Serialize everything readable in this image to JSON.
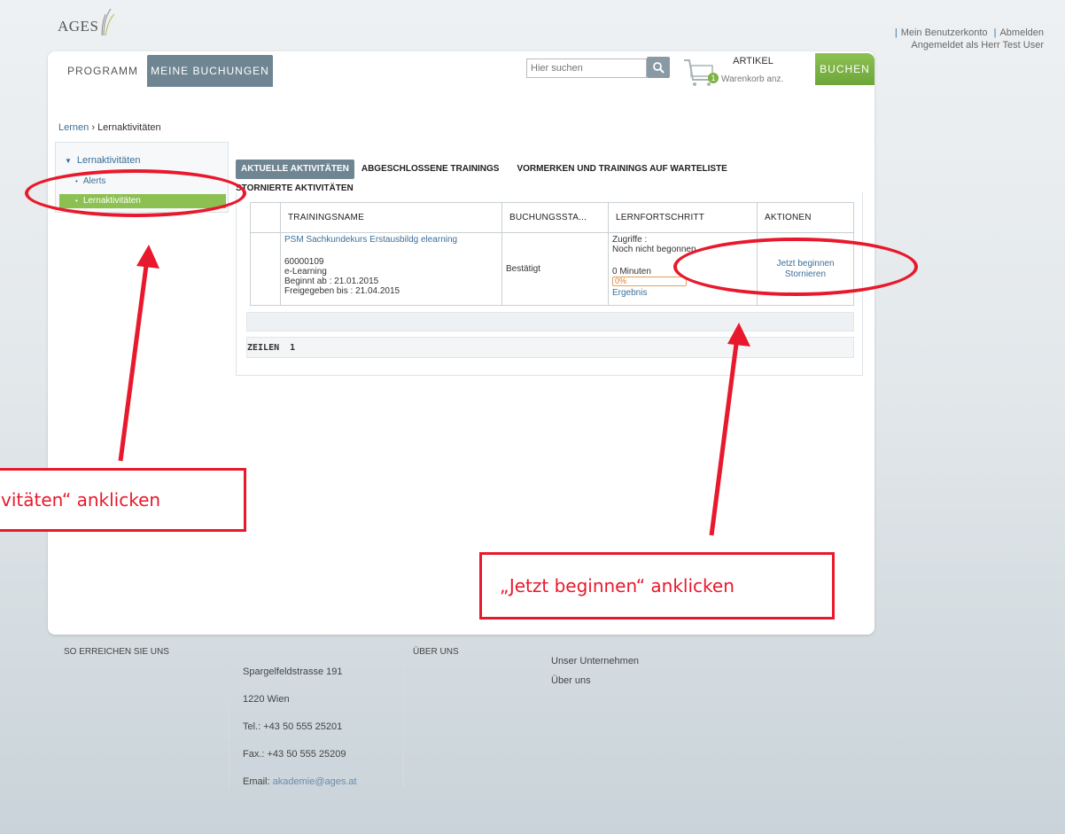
{
  "header": {
    "logo_text": "AGES",
    "account_link": "Mein Benutzerkonto",
    "logout_link": "Abmelden",
    "logged_in_as": "Angemeldet als Herr Test User"
  },
  "nav": {
    "programm": "PROGRAMM",
    "meine_buchungen": "MEINE BUCHUNGEN",
    "search_placeholder": "Hier suchen",
    "cart_count": "1",
    "cart_title": "ARTIKEL",
    "cart_sub": "Warenkorb anz.",
    "buchen": "BUCHEN"
  },
  "breadcrumb": {
    "root": "Lernen",
    "sep": "›",
    "current": "Lernaktivitäten"
  },
  "sidebar": {
    "heading": "Lernaktivitäten",
    "items": [
      {
        "label": "Alerts",
        "active": false
      },
      {
        "label": "Lernaktivitäten",
        "active": true
      }
    ]
  },
  "tabs": [
    {
      "label": "AKTUELLE AKTIVITÄTEN",
      "active": true
    },
    {
      "label": "ABGESCHLOSSENE TRAININGS",
      "active": false
    },
    {
      "label": "VORMERKEN UND TRAININGS AUF WARTELISTE",
      "active": false
    },
    {
      "label": "STORNIERTE AKTIVITÄTEN",
      "active": false
    }
  ],
  "table": {
    "columns": [
      "TRAININGSNAME",
      "BUCHUNGSSTA...",
      "LERNFORTSCHRITT",
      "AKTIONEN"
    ],
    "row": {
      "title": "PSM Sachkundekurs Erstausbildg elearning",
      "id": "60000109",
      "type": "e-Learning",
      "start": "Beginnt ab : 21.01.2015",
      "release": "Freigegeben bis : 21.04.2015",
      "status": "Bestätigt",
      "access_label": "Zugriffe :",
      "access_value": "Noch nicht begonnen",
      "minutes": "0 Minuten",
      "progress_pct": "0%",
      "result_link": "Ergebnis",
      "action_start": "Jetzt beginnen",
      "action_cancel": "Stornieren"
    },
    "rows_label": "ZEILEN",
    "rows_count": "1"
  },
  "footer": {
    "contact_heading": "SO ERREICHEN SIE UNS",
    "address": [
      "Spargelfeldstrasse 191",
      "1220 Wien",
      "Tel.: +43 50 555 25201",
      "Fax.: +43 50 555 25209"
    ],
    "email_label": "Email:",
    "email": "akademie@ages.at",
    "about_heading": "ÜBER UNS",
    "about_links": [
      "Unser Unternehmen",
      "Über uns"
    ]
  },
  "annotations": {
    "left_callout": "vitäten“ anklicken",
    "right_callout": "„Jetzt beginnen“ anklicken",
    "color": "#e8192c"
  }
}
